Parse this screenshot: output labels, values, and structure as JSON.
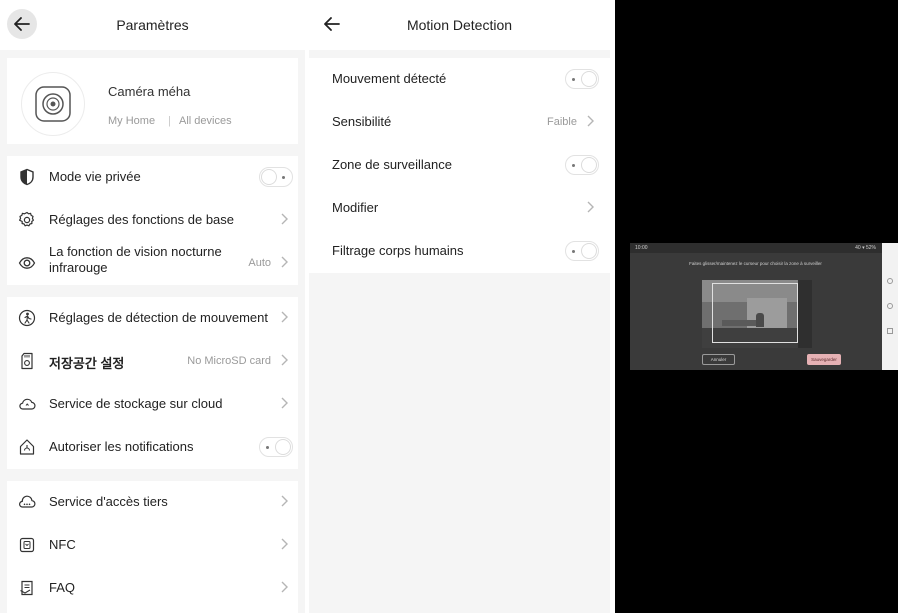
{
  "settings": {
    "title": "Paramètres",
    "device": {
      "name": "Caméra méha",
      "location": "My Home",
      "separator": "|",
      "group": "All devices"
    },
    "group1": [
      {
        "label": "Mode vie privée",
        "icon": "privacy-shield-icon",
        "control": "toggle-off"
      },
      {
        "label": "Réglages des fonctions de base",
        "icon": "gear-icon",
        "control": "chevron"
      },
      {
        "label": "La fonction de vision nocturne infrarouge",
        "value": "Auto",
        "icon": "eye-icon",
        "control": "chevron"
      }
    ],
    "group2": [
      {
        "label": "Réglages de détection de mouvement",
        "icon": "motion-person-icon",
        "control": "chevron"
      },
      {
        "label": "저장공간 설정",
        "value": "No MicroSD card",
        "icon": "sd-card-icon",
        "control": "chevron"
      },
      {
        "label": "Service de stockage sur cloud",
        "icon": "cloud-icon",
        "control": "chevron"
      },
      {
        "label": "Autoriser les notifications",
        "icon": "notification-icon",
        "control": "toggle-off"
      }
    ],
    "group3": [
      {
        "label": "Service d'accès tiers",
        "icon": "third-party-cloud-icon",
        "control": "chevron"
      },
      {
        "label": "NFC",
        "icon": "nfc-icon",
        "control": "chevron"
      },
      {
        "label": "FAQ",
        "icon": "faq-icon",
        "control": "chevron"
      }
    ]
  },
  "motion": {
    "title": "Motion Detection",
    "rows": [
      {
        "label": "Mouvement détecté",
        "control": "toggle-off"
      },
      {
        "label": "Sensibilité",
        "value": "Faible",
        "control": "chevron"
      },
      {
        "label": "Zone de surveillance",
        "control": "toggle-off"
      },
      {
        "label": "Modifier",
        "control": "chevron"
      },
      {
        "label": "Filtrage corps humains",
        "control": "toggle-off"
      }
    ]
  },
  "zone_editor": {
    "status_time": "10:00",
    "status_right": "40 ▾ 52%",
    "instruction": "Faites glisser/maintenez le curseur pour choisir la zone à surveiller",
    "cancel_label": "Annuler",
    "save_label": "Sauvegarder"
  }
}
